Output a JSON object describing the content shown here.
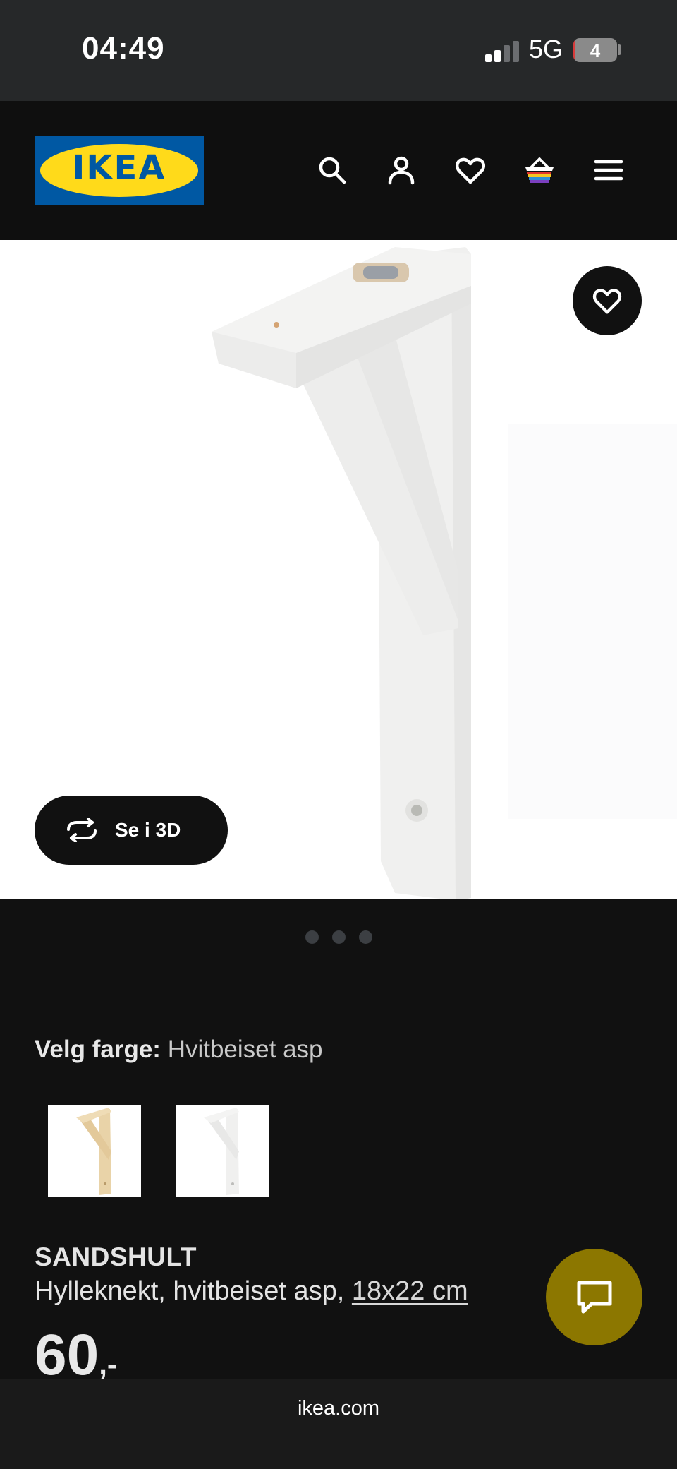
{
  "status_bar": {
    "time": "04:49",
    "network": "5G",
    "battery": "4",
    "battery_level_percent": 4,
    "signal_bars_active": 2,
    "signal_bars_total": 4
  },
  "header": {
    "logo_text": "IKEA",
    "icons": [
      "search-icon",
      "profile-icon",
      "heart-icon",
      "basket-icon",
      "menu-icon"
    ]
  },
  "hero": {
    "view_3d_label": "Se i 3D",
    "image_count": 3,
    "active_image": 1
  },
  "color_picker": {
    "label": "Velg farge:",
    "value": "Hvitbeiset asp",
    "swatches": [
      "natural-aspen-swatch",
      "white-stained-aspen-swatch"
    ]
  },
  "product": {
    "name": "SANDSHULT",
    "description": "Hylleknekt, hvitbeiset asp, ",
    "size": "18x22 cm",
    "price": "60",
    "price_suffix": ",-"
  },
  "browser": {
    "url": "ikea.com"
  },
  "colors": {
    "brand_blue": "#0058a3",
    "brand_yellow": "#ffda1a",
    "chat_button": "#8c7700",
    "background": "#111111"
  }
}
